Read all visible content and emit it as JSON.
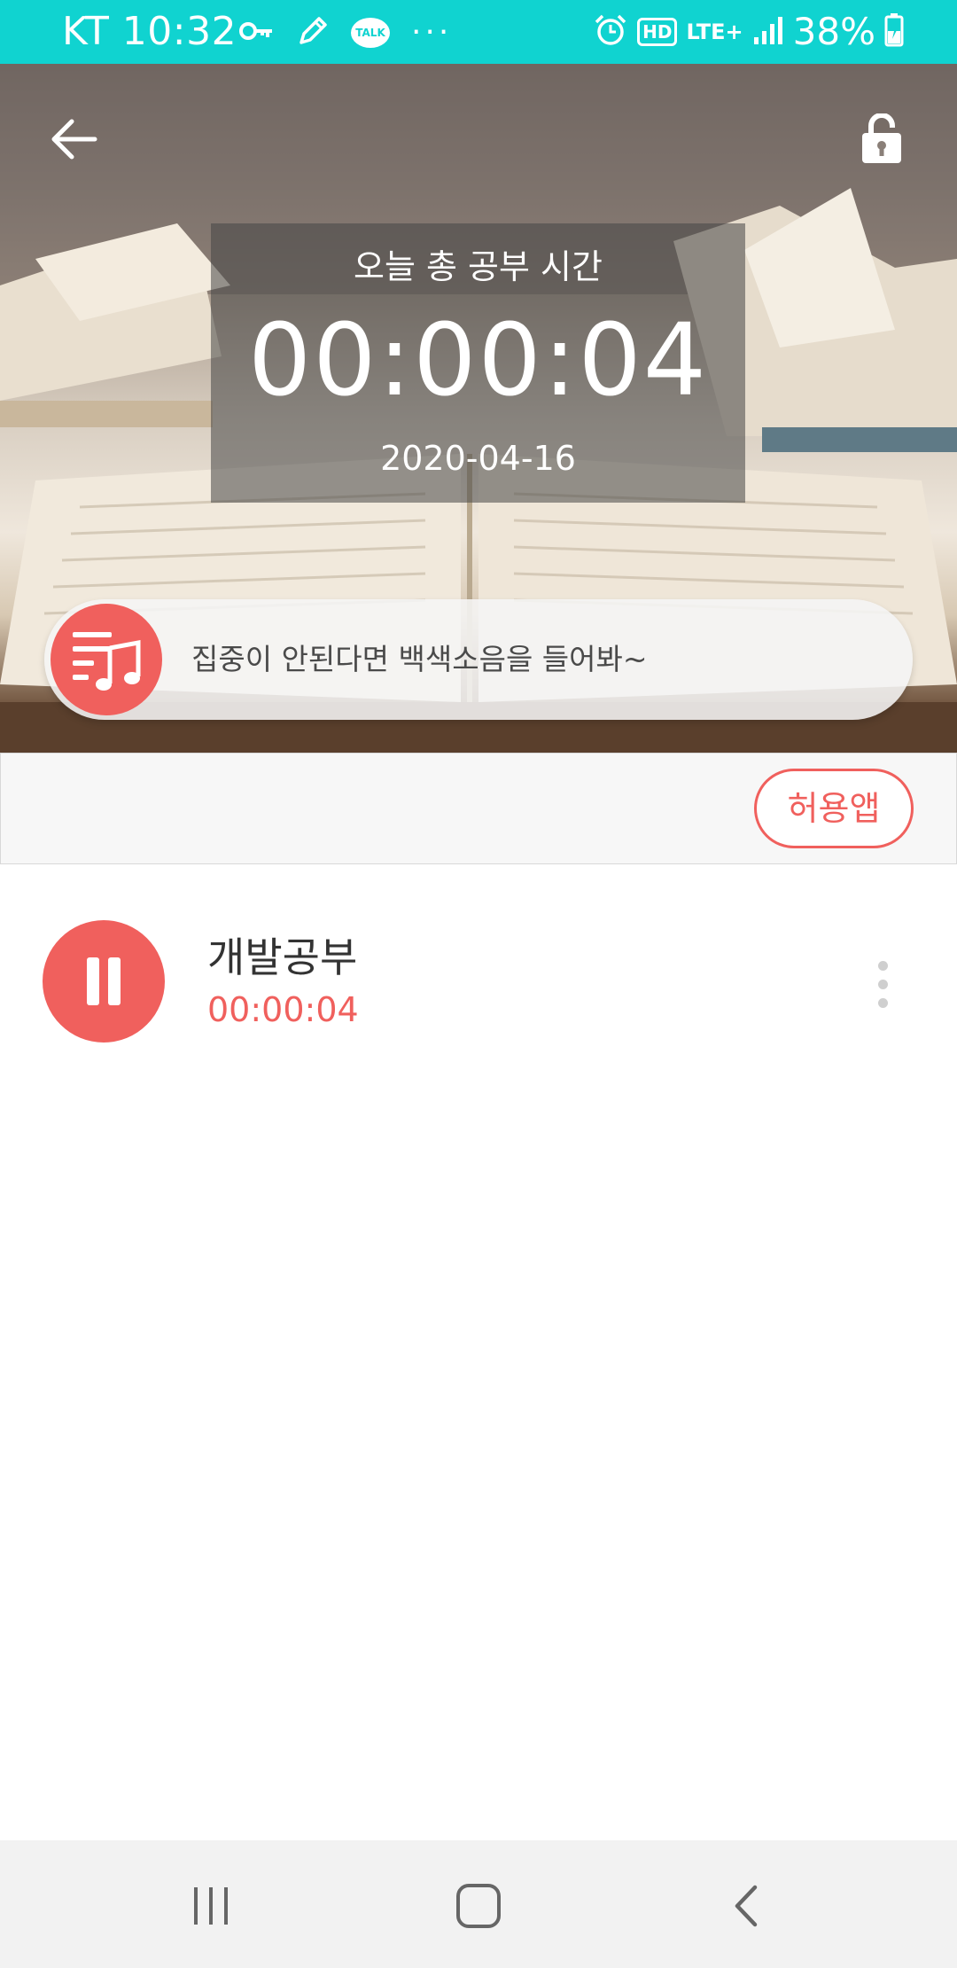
{
  "status_bar": {
    "carrier_time": "KT 10:32",
    "talk_label": "TALK",
    "more": "···",
    "hd": "HD",
    "network": "LTE+",
    "battery": "38%",
    "icons": [
      "key-icon",
      "pencil-icon",
      "talk-icon",
      "alarm-icon",
      "hd-icon",
      "lte-icon",
      "signal-icon",
      "battery-icon"
    ],
    "background": "#10d3d0"
  },
  "hero": {
    "title_label": "오늘 총 공부 시간",
    "total_time": "00:00:04",
    "date": "2020-04-16",
    "music_prompt": "집중이 안된다면 백색소음을 들어봐~"
  },
  "toolbar": {
    "allowed_apps_label": "허용앱"
  },
  "subjects": [
    {
      "name": "개발공부",
      "time": "00:00:04",
      "state": "running"
    }
  ],
  "colors": {
    "accent": "#f0605d",
    "status_bar": "#10d3d0",
    "text_dark": "#333333"
  },
  "nav": {
    "icons": [
      "recent-apps-icon",
      "home-icon",
      "back-nav-icon"
    ]
  }
}
